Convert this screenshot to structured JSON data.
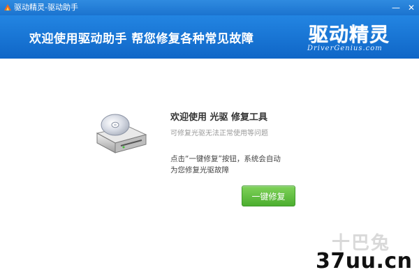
{
  "window": {
    "title": "驱动精灵-驱动助手",
    "controls": {
      "minimize": "—",
      "close": "✕"
    }
  },
  "banner": {
    "headline": "欢迎使用驱动助手  帮您修复各种常见故障",
    "logo_cn": "驱动精灵",
    "logo_en": "DriverGenius.com"
  },
  "main": {
    "tool_title": "欢迎使用 光驱 修复工具",
    "tool_subtitle": "可修复光驱无法正常使用等问题",
    "description_line1": "点击“一键修复”按钮，系统会自动",
    "description_line2": "为您修复光驱故障",
    "fix_button_label": "一键修复"
  },
  "watermark": {
    "cn": "十巴兔",
    "site": "37uu.cn"
  },
  "colors": {
    "banner_blue": "#1a78d6",
    "button_green": "#5cbf3a"
  },
  "icons": {
    "app": "app-logo-icon",
    "drive": "optical-drive-icon"
  }
}
